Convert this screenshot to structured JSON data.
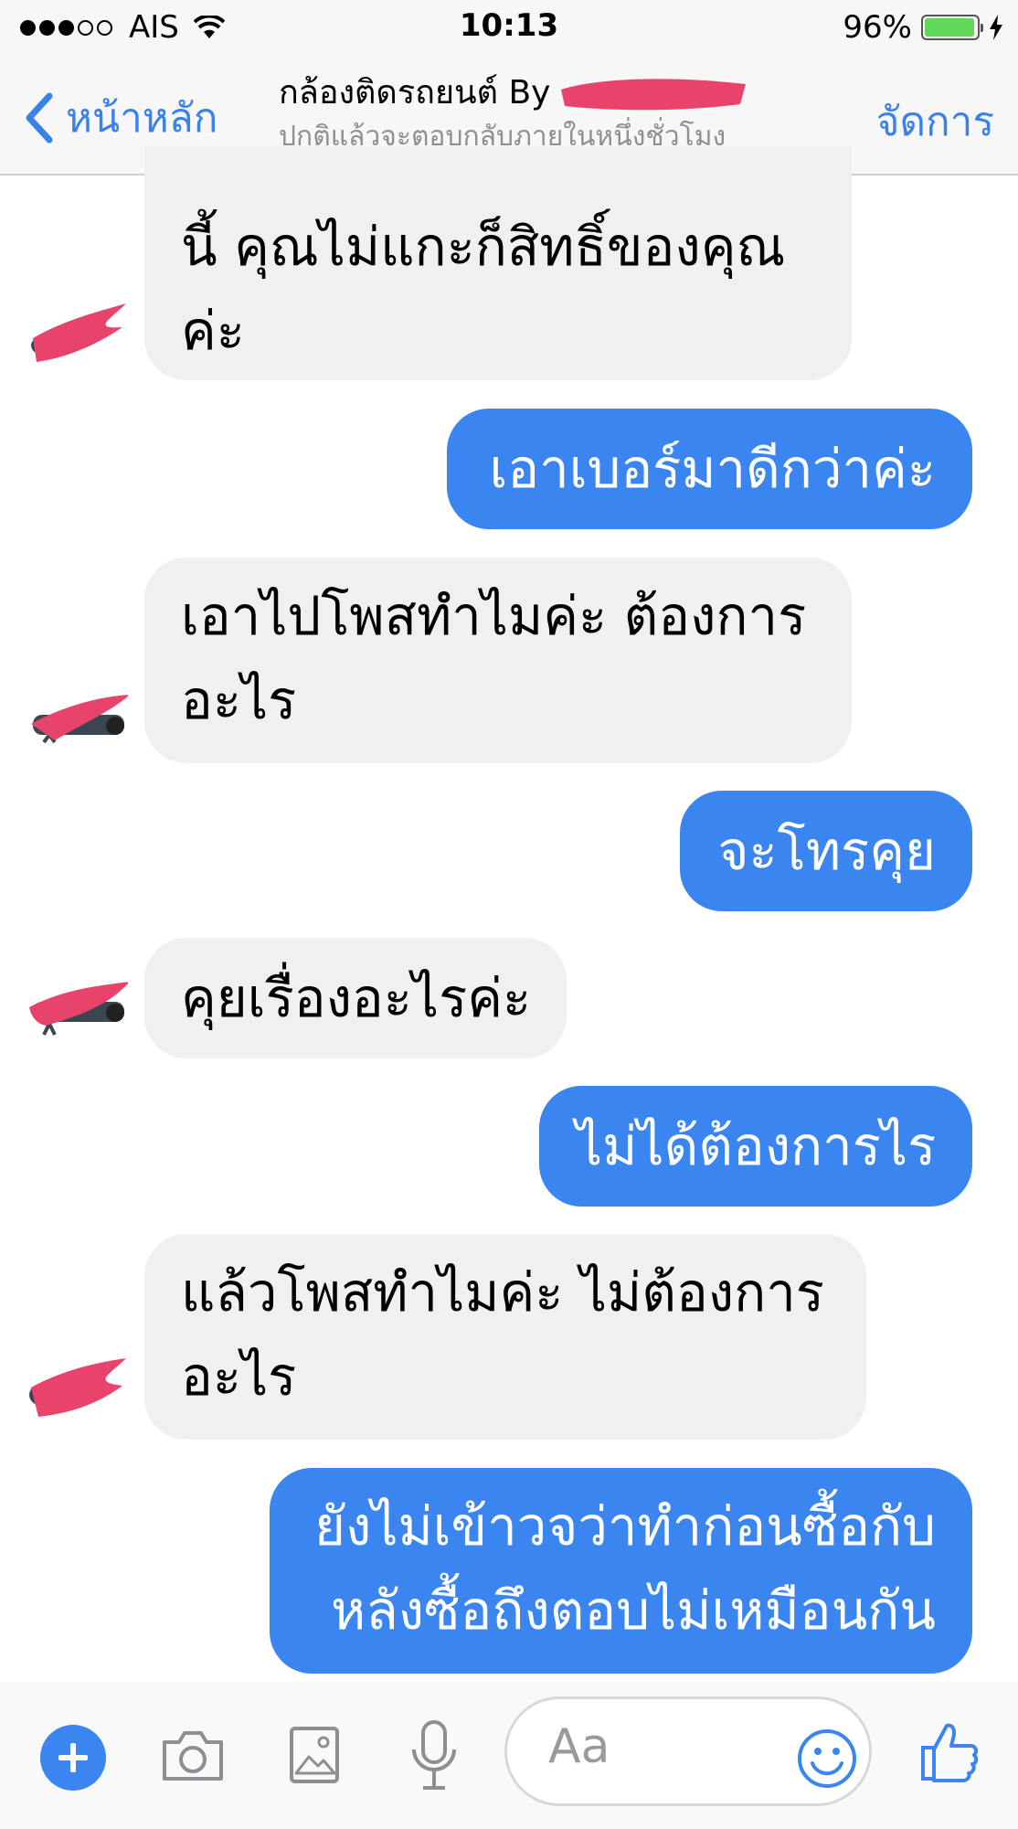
{
  "status_bar": {
    "carrier": "AIS",
    "time": "10:13",
    "battery": "96%",
    "battery_level": 0.96
  },
  "nav": {
    "back_label": "หน้าหลัก",
    "title": "กล้องติดรถยนต์ By",
    "subtitle": "ปกติแล้วจะตอบกลับภายในหนึ่งชั่วโมง",
    "manage_label": "จัดการ"
  },
  "messages": [
    {
      "side": "incoming",
      "lines": [
        "นี้ คุณไม่แกะก็สิทธิ์ของคุณ",
        "ค่ะ"
      ]
    },
    {
      "side": "outgoing",
      "lines": [
        "เอาเบอร์มาดีกว่าค่ะ"
      ]
    },
    {
      "side": "incoming",
      "lines": [
        "เอาไปโพสทำไมค่ะ ต้องการ",
        "อะไร"
      ]
    },
    {
      "side": "outgoing",
      "lines": [
        "จะโทรคุย"
      ]
    },
    {
      "side": "incoming",
      "lines": [
        "คุยเรื่องอะไรค่ะ"
      ]
    },
    {
      "side": "outgoing",
      "lines": [
        "ไม่ได้ต้องการไร"
      ]
    },
    {
      "side": "incoming",
      "lines": [
        "แล้วโพสทำไมค่ะ ไม่ต้องการ",
        "อะไร"
      ]
    },
    {
      "side": "outgoing",
      "lines": [
        "ยังไม่เข้าวจว่าทำก่อนซื้อกับ",
        "หลังซื้อถึงตอบไม่เหมือนกัน"
      ]
    }
  ],
  "composer": {
    "placeholder": "Aa"
  },
  "colors": {
    "accent": "#3b82e8",
    "outgoing_bubble": "#3a85f0",
    "incoming_bubble": "#f0f0f0",
    "redaction": "#e8436a"
  },
  "icons": [
    "wifi-icon",
    "battery-icon",
    "charging-icon",
    "back-chevron-icon",
    "plus-icon",
    "camera-icon",
    "photo-icon",
    "microphone-icon",
    "emoji-icon",
    "thumbs-up-icon"
  ]
}
